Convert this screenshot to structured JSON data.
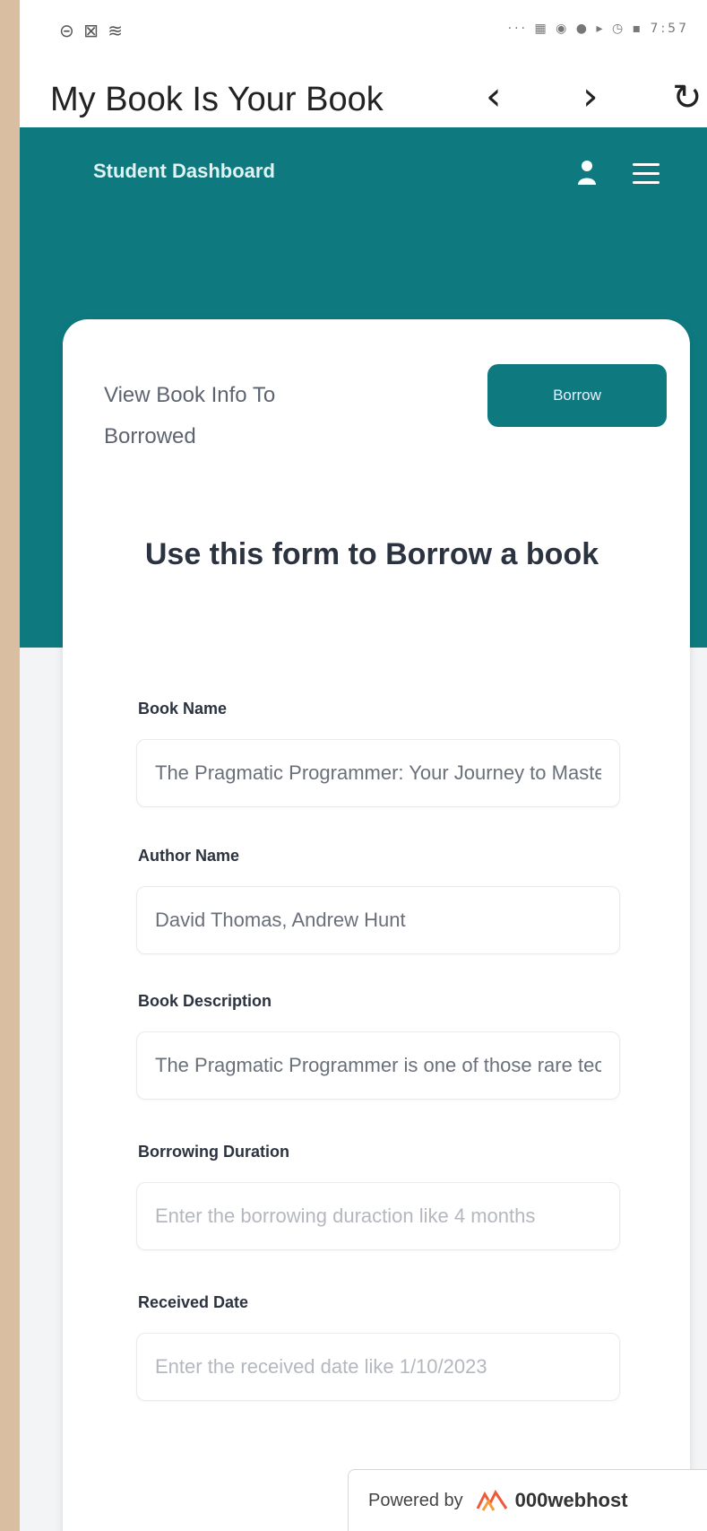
{
  "status_bar": {
    "left_icons": "⊝ ⊠ ≋",
    "right_icons": "··· ▦ ◉ ● ▸ ◷ ▪ 7:57"
  },
  "browser": {
    "title": "My Book Is Your Book",
    "back_glyph": "‹",
    "forward_glyph": "›",
    "reload_glyph": "↻"
  },
  "header": {
    "dashboard_title": "Student Dashboard",
    "user_icon": "user-icon",
    "menu_icon": "hamburger-menu-icon"
  },
  "card": {
    "view_info_text": "View Book Info To Borrowed",
    "borrow_button": "Borrow",
    "form_heading": "Use this form to Borrow a book"
  },
  "form": {
    "book_name": {
      "label": "Book Name",
      "value": "The Pragmatic Programmer: Your Journey to Mastery"
    },
    "author_name": {
      "label": "Author Name",
      "value": "David Thomas, Andrew Hunt"
    },
    "book_description": {
      "label": "Book Description",
      "value": "The Pragmatic Programmer is one of those rare tech books"
    },
    "borrowing_duration": {
      "label": "Borrowing Duration",
      "placeholder": "Enter the borrowing duraction like 4 months"
    },
    "received_date": {
      "label": "Received Date",
      "placeholder": "Enter the received date like 1/10/2023"
    }
  },
  "footer": {
    "powered_by": "Powered by",
    "brand": "000webhost"
  },
  "colors": {
    "teal": "#0e7a80",
    "background": "#f2f4f6",
    "frame": "#d9bea2"
  }
}
